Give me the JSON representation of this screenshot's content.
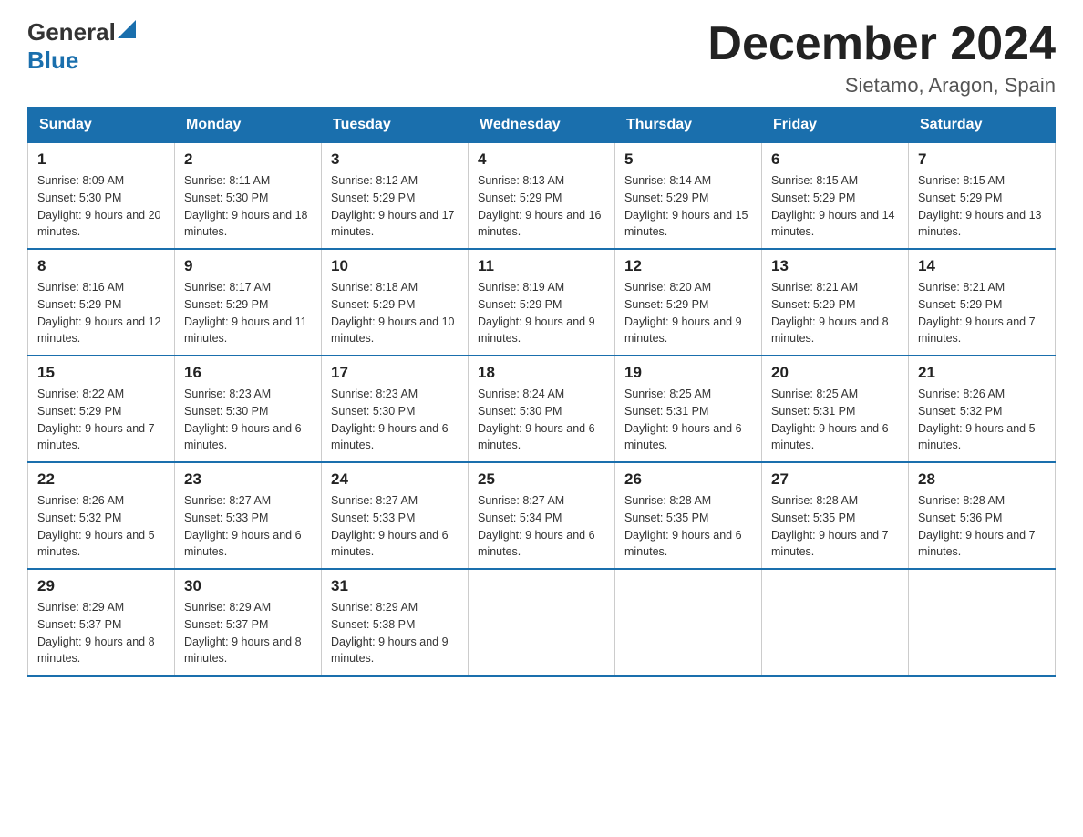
{
  "header": {
    "logo_general": "General",
    "logo_blue": "Blue",
    "title": "December 2024",
    "location": "Sietamo, Aragon, Spain"
  },
  "days_of_week": [
    "Sunday",
    "Monday",
    "Tuesday",
    "Wednesday",
    "Thursday",
    "Friday",
    "Saturday"
  ],
  "weeks": [
    [
      {
        "day": "1",
        "sunrise": "8:09 AM",
        "sunset": "5:30 PM",
        "daylight": "9 hours and 20 minutes."
      },
      {
        "day": "2",
        "sunrise": "8:11 AM",
        "sunset": "5:30 PM",
        "daylight": "9 hours and 18 minutes."
      },
      {
        "day": "3",
        "sunrise": "8:12 AM",
        "sunset": "5:29 PM",
        "daylight": "9 hours and 17 minutes."
      },
      {
        "day": "4",
        "sunrise": "8:13 AM",
        "sunset": "5:29 PM",
        "daylight": "9 hours and 16 minutes."
      },
      {
        "day": "5",
        "sunrise": "8:14 AM",
        "sunset": "5:29 PM",
        "daylight": "9 hours and 15 minutes."
      },
      {
        "day": "6",
        "sunrise": "8:15 AM",
        "sunset": "5:29 PM",
        "daylight": "9 hours and 14 minutes."
      },
      {
        "day": "7",
        "sunrise": "8:15 AM",
        "sunset": "5:29 PM",
        "daylight": "9 hours and 13 minutes."
      }
    ],
    [
      {
        "day": "8",
        "sunrise": "8:16 AM",
        "sunset": "5:29 PM",
        "daylight": "9 hours and 12 minutes."
      },
      {
        "day": "9",
        "sunrise": "8:17 AM",
        "sunset": "5:29 PM",
        "daylight": "9 hours and 11 minutes."
      },
      {
        "day": "10",
        "sunrise": "8:18 AM",
        "sunset": "5:29 PM",
        "daylight": "9 hours and 10 minutes."
      },
      {
        "day": "11",
        "sunrise": "8:19 AM",
        "sunset": "5:29 PM",
        "daylight": "9 hours and 9 minutes."
      },
      {
        "day": "12",
        "sunrise": "8:20 AM",
        "sunset": "5:29 PM",
        "daylight": "9 hours and 9 minutes."
      },
      {
        "day": "13",
        "sunrise": "8:21 AM",
        "sunset": "5:29 PM",
        "daylight": "9 hours and 8 minutes."
      },
      {
        "day": "14",
        "sunrise": "8:21 AM",
        "sunset": "5:29 PM",
        "daylight": "9 hours and 7 minutes."
      }
    ],
    [
      {
        "day": "15",
        "sunrise": "8:22 AM",
        "sunset": "5:29 PM",
        "daylight": "9 hours and 7 minutes."
      },
      {
        "day": "16",
        "sunrise": "8:23 AM",
        "sunset": "5:30 PM",
        "daylight": "9 hours and 6 minutes."
      },
      {
        "day": "17",
        "sunrise": "8:23 AM",
        "sunset": "5:30 PM",
        "daylight": "9 hours and 6 minutes."
      },
      {
        "day": "18",
        "sunrise": "8:24 AM",
        "sunset": "5:30 PM",
        "daylight": "9 hours and 6 minutes."
      },
      {
        "day": "19",
        "sunrise": "8:25 AM",
        "sunset": "5:31 PM",
        "daylight": "9 hours and 6 minutes."
      },
      {
        "day": "20",
        "sunrise": "8:25 AM",
        "sunset": "5:31 PM",
        "daylight": "9 hours and 6 minutes."
      },
      {
        "day": "21",
        "sunrise": "8:26 AM",
        "sunset": "5:32 PM",
        "daylight": "9 hours and 5 minutes."
      }
    ],
    [
      {
        "day": "22",
        "sunrise": "8:26 AM",
        "sunset": "5:32 PM",
        "daylight": "9 hours and 5 minutes."
      },
      {
        "day": "23",
        "sunrise": "8:27 AM",
        "sunset": "5:33 PM",
        "daylight": "9 hours and 6 minutes."
      },
      {
        "day": "24",
        "sunrise": "8:27 AM",
        "sunset": "5:33 PM",
        "daylight": "9 hours and 6 minutes."
      },
      {
        "day": "25",
        "sunrise": "8:27 AM",
        "sunset": "5:34 PM",
        "daylight": "9 hours and 6 minutes."
      },
      {
        "day": "26",
        "sunrise": "8:28 AM",
        "sunset": "5:35 PM",
        "daylight": "9 hours and 6 minutes."
      },
      {
        "day": "27",
        "sunrise": "8:28 AM",
        "sunset": "5:35 PM",
        "daylight": "9 hours and 7 minutes."
      },
      {
        "day": "28",
        "sunrise": "8:28 AM",
        "sunset": "5:36 PM",
        "daylight": "9 hours and 7 minutes."
      }
    ],
    [
      {
        "day": "29",
        "sunrise": "8:29 AM",
        "sunset": "5:37 PM",
        "daylight": "9 hours and 8 minutes."
      },
      {
        "day": "30",
        "sunrise": "8:29 AM",
        "sunset": "5:37 PM",
        "daylight": "9 hours and 8 minutes."
      },
      {
        "day": "31",
        "sunrise": "8:29 AM",
        "sunset": "5:38 PM",
        "daylight": "9 hours and 9 minutes."
      },
      null,
      null,
      null,
      null
    ]
  ]
}
